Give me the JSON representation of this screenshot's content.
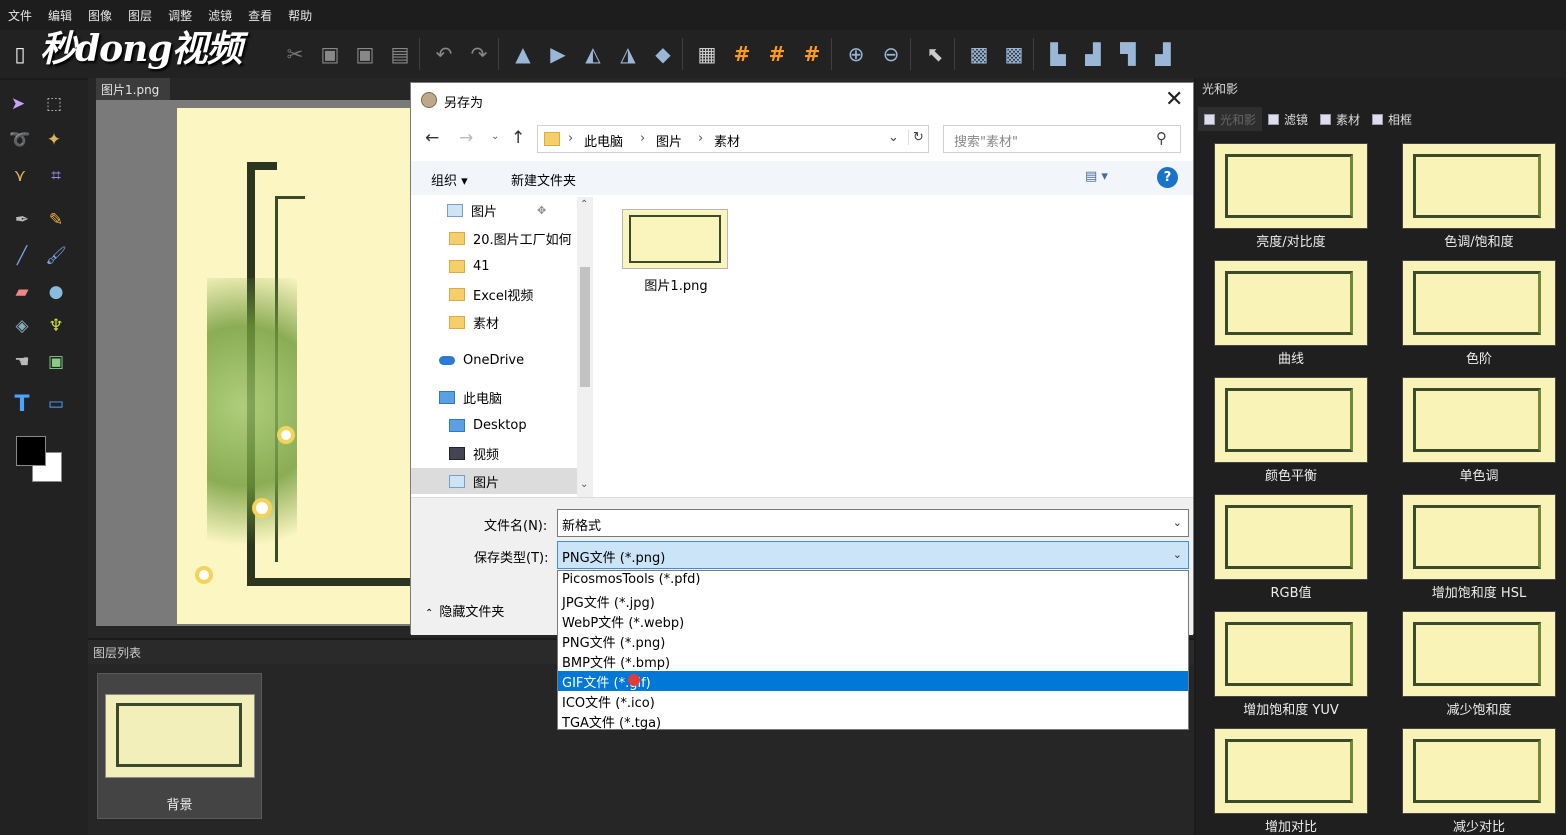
{
  "menu": [
    "文件",
    "编辑",
    "图像",
    "图层",
    "调整",
    "滤镜",
    "查看",
    "帮助"
  ],
  "watermark": "秒dong视频",
  "doc_tab": "图片1.png",
  "layers": {
    "header": "图层列表",
    "items": [
      {
        "name": "背景"
      }
    ]
  },
  "right_panel": {
    "title": "光和影",
    "tabs": [
      "光和影",
      "滤镜",
      "素材",
      "相框"
    ],
    "items": [
      "亮度/对比度",
      "色调/饱和度",
      "曲线",
      "色阶",
      "颜色平衡",
      "单色调",
      "RGB值",
      "增加饱和度 HSL",
      "增加饱和度 YUV",
      "减少饱和度",
      "增加对比",
      "减少对比"
    ]
  },
  "dialog": {
    "title": "另存为",
    "close": "✕",
    "breadcrumb": [
      "此电脑",
      "图片",
      "素材"
    ],
    "search_placeholder": "搜索\"素材\"",
    "organize": "组织 ▾",
    "new_folder": "新建文件夹",
    "help": "?",
    "nav": [
      {
        "label": "图片",
        "icon": "image-folder-icon"
      },
      {
        "label": "20.图片工厂如何",
        "icon": "folder-icon"
      },
      {
        "label": "41",
        "icon": "folder-icon"
      },
      {
        "label": "Excel视频",
        "icon": "folder-icon"
      },
      {
        "label": "素材",
        "icon": "folder-icon"
      },
      {
        "label": "OneDrive",
        "icon": "cloud-icon"
      },
      {
        "label": "此电脑",
        "icon": "computer-icon"
      },
      {
        "label": "Desktop",
        "icon": "desktop-icon"
      },
      {
        "label": "视频",
        "icon": "video-folder-icon"
      },
      {
        "label": "图片",
        "icon": "image-folder-icon"
      }
    ],
    "file": {
      "name": "图片1.png"
    },
    "filename_label": "文件名(N):",
    "filename_value": "新格式",
    "filetype_label": "保存类型(T):",
    "filetype_value": "PNG文件 (*.png)",
    "hide_folders": "隐藏文件夹",
    "filetype_options": [
      "PicosmosTools (*.pfd)",
      "JPG文件 (*.jpg)",
      "WebP文件 (*.webp)",
      "PNG文件 (*.png)",
      "BMP文件 (*.bmp)",
      "GIF文件 (*.gif)",
      "ICO文件 (*.ico)",
      "TGA文件 (*.tga)"
    ],
    "selected_option_index": 5
  }
}
